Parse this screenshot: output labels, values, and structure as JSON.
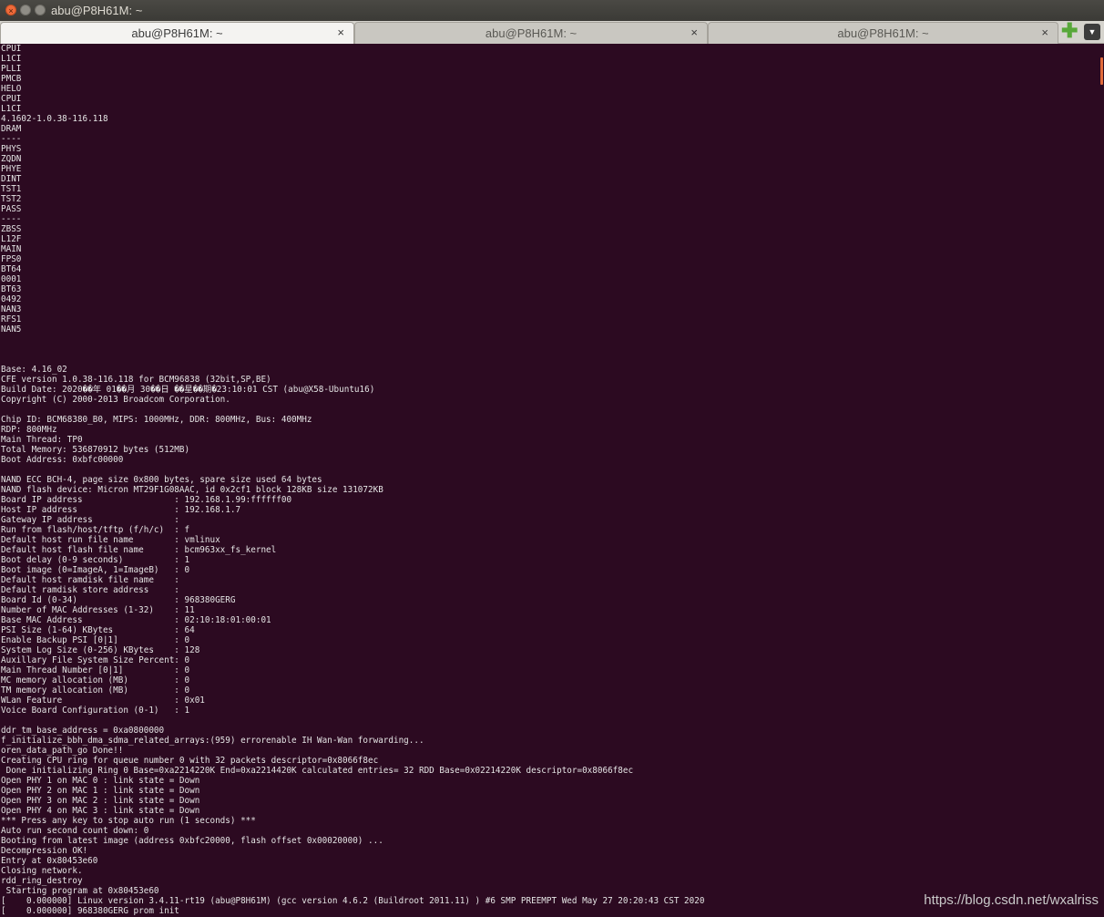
{
  "window": {
    "title": "abu@P8H61M: ~",
    "close_glyph": "×",
    "min_glyph": "",
    "max_glyph": ""
  },
  "tabs": [
    {
      "label": "abu@P8H61M: ~",
      "active": true,
      "close": "×"
    },
    {
      "label": "abu@P8H61M: ~",
      "active": false,
      "close": "×"
    },
    {
      "label": "abu@P8H61M: ~",
      "active": false,
      "close": "×"
    }
  ],
  "tab_actions": {
    "new_tab_glyph": "✚",
    "menu_glyph": "▼"
  },
  "terminal": {
    "text": "CPUI\nL1CI\nPLLI\nPMCB\nHELO\nCPUI\nL1CI\n4.1602-1.0.38-116.118\nDRAM\n----\nPHYS\nZQDN\nPHYE\nDINT\nTST1\nTST2\nPASS\n----\nZBSS\nL12F\nMAIN\nFPS0\nBT64\n0001\nBT63\n0492\nNAN3\nRFS1\nNAN5\n\n\n\nBase: 4.16_02\nCFE version 1.0.38-116.118 for BCM96838 (32bit,SP,BE)\nBuild Date: 2020��年 01��月 30��日 ��星��期�23:10:01 CST (abu@X58-Ubuntu16)\nCopyright (C) 2000-2013 Broadcom Corporation.\n\nChip ID: BCM68380_B0, MIPS: 1000MHz, DDR: 800MHz, Bus: 400MHz\nRDP: 800MHz\nMain Thread: TP0\nTotal Memory: 536870912 bytes (512MB)\nBoot Address: 0xbfc00000\n\nNAND ECC BCH-4, page size 0x800 bytes, spare size used 64 bytes\nNAND flash device: Micron MT29F1G08AAC, id 0x2cf1 block 128KB size 131072KB\nBoard IP address                  : 192.168.1.99:ffffff00\nHost IP address                   : 192.168.1.7\nGateway IP address                :\nRun from flash/host/tftp (f/h/c)  : f\nDefault host run file name        : vmlinux\nDefault host flash file name      : bcm963xx_fs_kernel\nBoot delay (0-9 seconds)          : 1\nBoot image (0=ImageA, 1=ImageB)   : 0\nDefault host ramdisk file name    :\nDefault ramdisk store address     :\nBoard Id (0-34)                   : 968380GERG\nNumber of MAC Addresses (1-32)    : 11\nBase MAC Address                  : 02:10:18:01:00:01\nPSI Size (1-64) KBytes            : 64\nEnable Backup PSI [0|1]           : 0\nSystem Log Size (0-256) KBytes    : 128\nAuxillary File System Size Percent: 0\nMain Thread Number [0|1]          : 0\nMC memory allocation (MB)         : 0\nTM memory allocation (MB)         : 0\nWLan Feature                      : 0x01\nVoice Board Configuration (0-1)   : 1\n\nddr_tm_base_address = 0xa0800000\nf_initialize_bbh_dma_sdma_related_arrays:(959) errorenable IH Wan-Wan forwarding...\noren_data_path_go Done!!\nCreating CPU ring for queue number 0 with 32 packets descriptor=0x8066f8ec\n Done initializing Ring 0 Base=0xa2214220K End=0xa2214420K calculated entries= 32 RDD Base=0x02214220K descriptor=0x8066f8ec\nOpen PHY 1 on MAC 0 : link state = Down\nOpen PHY 2 on MAC 1 : link state = Down\nOpen PHY 3 on MAC 2 : link state = Down\nOpen PHY 4 on MAC 3 : link state = Down\n*** Press any key to stop auto run (1 seconds) ***\nAuto run second count down: 0\nBooting from latest image (address 0xbfc20000, flash offset 0x00020000) ...\nDecompression OK!\nEntry at 0x80453e60\nClosing network.\nrdd_ring_destroy\n Starting program at 0x80453e60\n[    0.000000] Linux version 3.4.11-rt19 (abu@P8H61M) (gcc version 4.6.2 (Buildroot 2011.11) ) #6 SMP PREEMPT Wed May 27 20:20:43 CST 2020\n[    0.000000] 968380GERG prom init"
  },
  "watermark": "https://blog.csdn.net/wxalriss"
}
